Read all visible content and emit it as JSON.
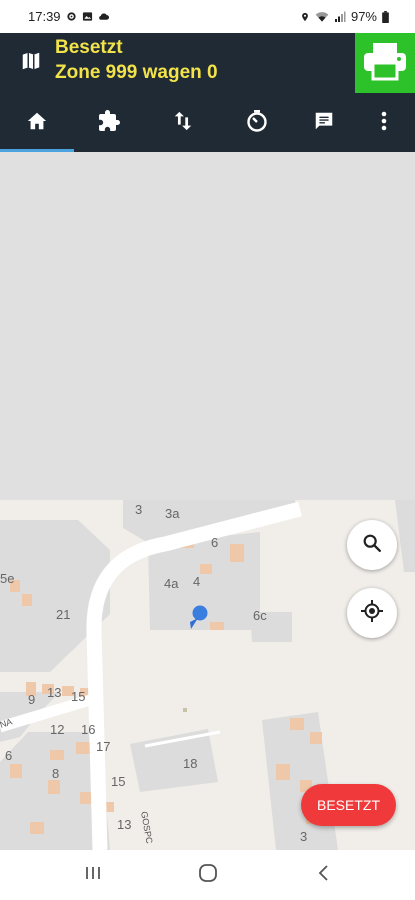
{
  "status_bar": {
    "time": "17:39",
    "battery": "97%"
  },
  "header": {
    "line1": "Besetzt",
    "line2": "Zone 999 wagen 0"
  },
  "nav_tabs": [
    "home-icon",
    "puzzle-icon",
    "swap-vertical-icon",
    "timer-icon",
    "message-icon",
    "more-vert-icon"
  ],
  "map": {
    "house_numbers": [
      "3",
      "3a",
      "6",
      "4a",
      "4",
      "6c",
      "5e",
      "21",
      "9",
      "13",
      "15",
      "12",
      "16",
      "17",
      "6",
      "8",
      "18",
      "15",
      "13",
      "3"
    ],
    "street_labels": [
      "GOSPC",
      "NA"
    ]
  },
  "action_button": {
    "label": "BESETZT"
  },
  "colors": {
    "header_bg": "#1f2a34",
    "title_text": "#f2e34a",
    "print_bg": "#2ec22a",
    "action_bg": "#f0393b",
    "map_bg": "#e0e0e0"
  }
}
